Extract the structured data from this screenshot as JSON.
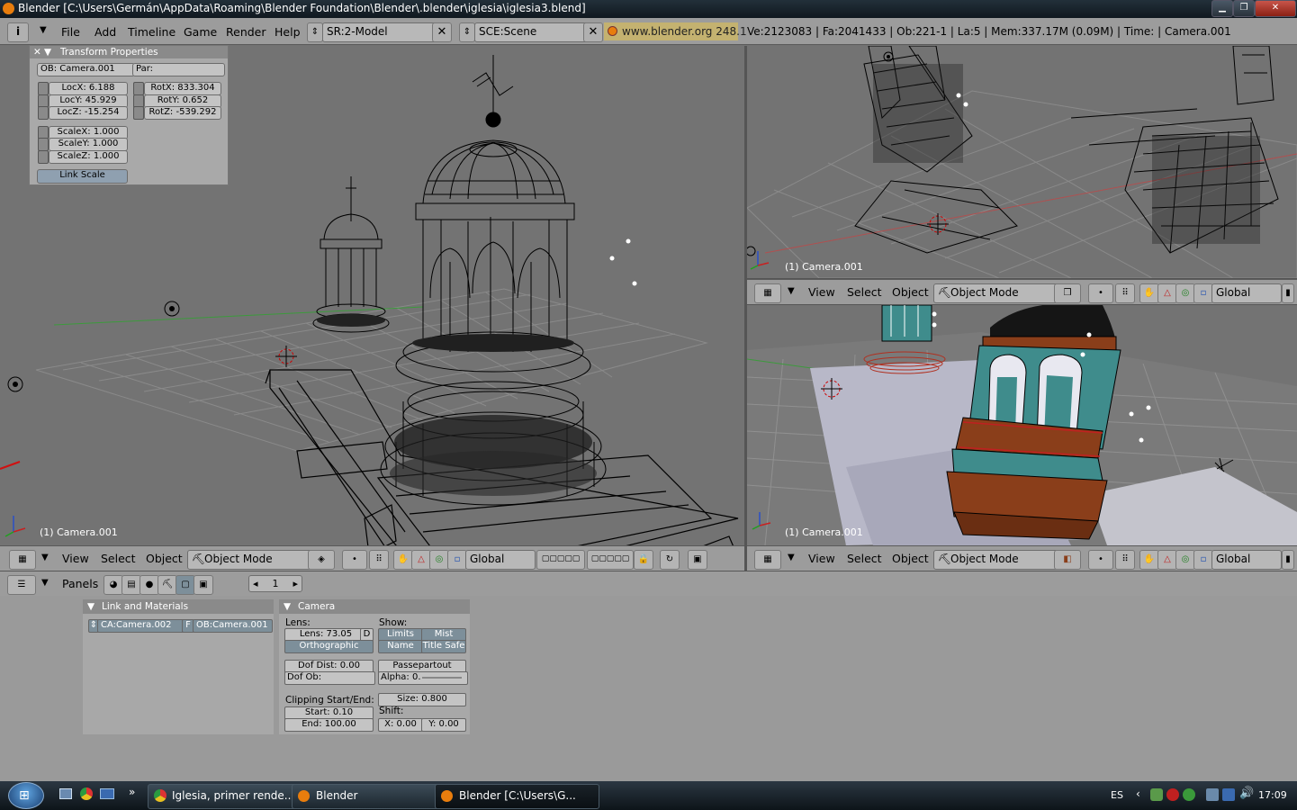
{
  "window": {
    "title": "Blender [C:\\Users\\Germán\\AppData\\Roaming\\Blender Foundation\\Blender\\.blender\\iglesia\\iglesia3.blend]",
    "min_icon": "minimize-icon",
    "max_icon": "maximize-icon",
    "close_icon": "close-icon"
  },
  "header": {
    "menus": [
      "File",
      "Add",
      "Timeline",
      "Game",
      "Render",
      "Help"
    ],
    "screen": "SR:2-Model",
    "scene": "SCE:Scene",
    "website": "www.blender.org 248.1",
    "stats": "Ve:2123083 | Fa:2041433 | Ob:221-1 | La:5  | Mem:337.17M (0.09M)  | Time: | Camera.001"
  },
  "transform": {
    "title": "Transform Properties",
    "ob": "OB: Camera.001",
    "par": "Par:",
    "locx": "LocX: 6.188",
    "locy": "LocY: 45.929",
    "locz": "LocZ: -15.254",
    "rotx": "RotX: 833.304",
    "roty": "RotY: 0.652",
    "rotz": "RotZ: -539.292",
    "scalex": "ScaleX: 1.000",
    "scaley": "ScaleY: 1.000",
    "scalez": "ScaleZ: 1.000",
    "link_scale": "Link Scale"
  },
  "viewports": {
    "main_label": "(1) Camera.001",
    "top_right_label": "(1) Camera.001",
    "bottom_right_label": "(1) Camera.001"
  },
  "vp_header": {
    "view": "View",
    "select": "Select",
    "object": "Object",
    "mode": "Object Mode",
    "orientation": "Global"
  },
  "buttons_header": {
    "panels": "Panels",
    "frame": "1"
  },
  "link_panel": {
    "title": "Link and Materials",
    "ca": "CA:Camera.002",
    "f": "F",
    "ob": "OB:Camera.001"
  },
  "camera_panel": {
    "title": "Camera",
    "lens_label": "Lens:",
    "lens": "Lens: 73.05",
    "d": "D",
    "orthographic": "Orthographic",
    "show_label": "Show:",
    "limits": "Limits",
    "mist": "Mist",
    "name": "Name",
    "title_safe": "Title Safe",
    "dof_dist": "Dof Dist: 0.00",
    "dof_ob": "Dof Ob:",
    "passepartout": "Passepartout",
    "alpha": "Alpha: 0.",
    "clipping_label": "Clipping Start/End:",
    "start": "Start: 0.10",
    "end": "End: 100.00",
    "size": "Size: 0.800",
    "shift_label": "Shift:",
    "shift_x": "X: 0.00",
    "shift_y": "Y: 0.00"
  },
  "taskbar": {
    "tasks": [
      "Iglesia, primer rende...",
      "Blender",
      "Blender [C:\\Users\\G..."
    ],
    "lang": "ES",
    "clock": "17:09"
  },
  "colors": {
    "viewport_bg": "#737373",
    "header_bg": "#9c9c9c",
    "wire": "#000000",
    "teal": "#3f8c8c",
    "brown": "#8a3e1a"
  }
}
